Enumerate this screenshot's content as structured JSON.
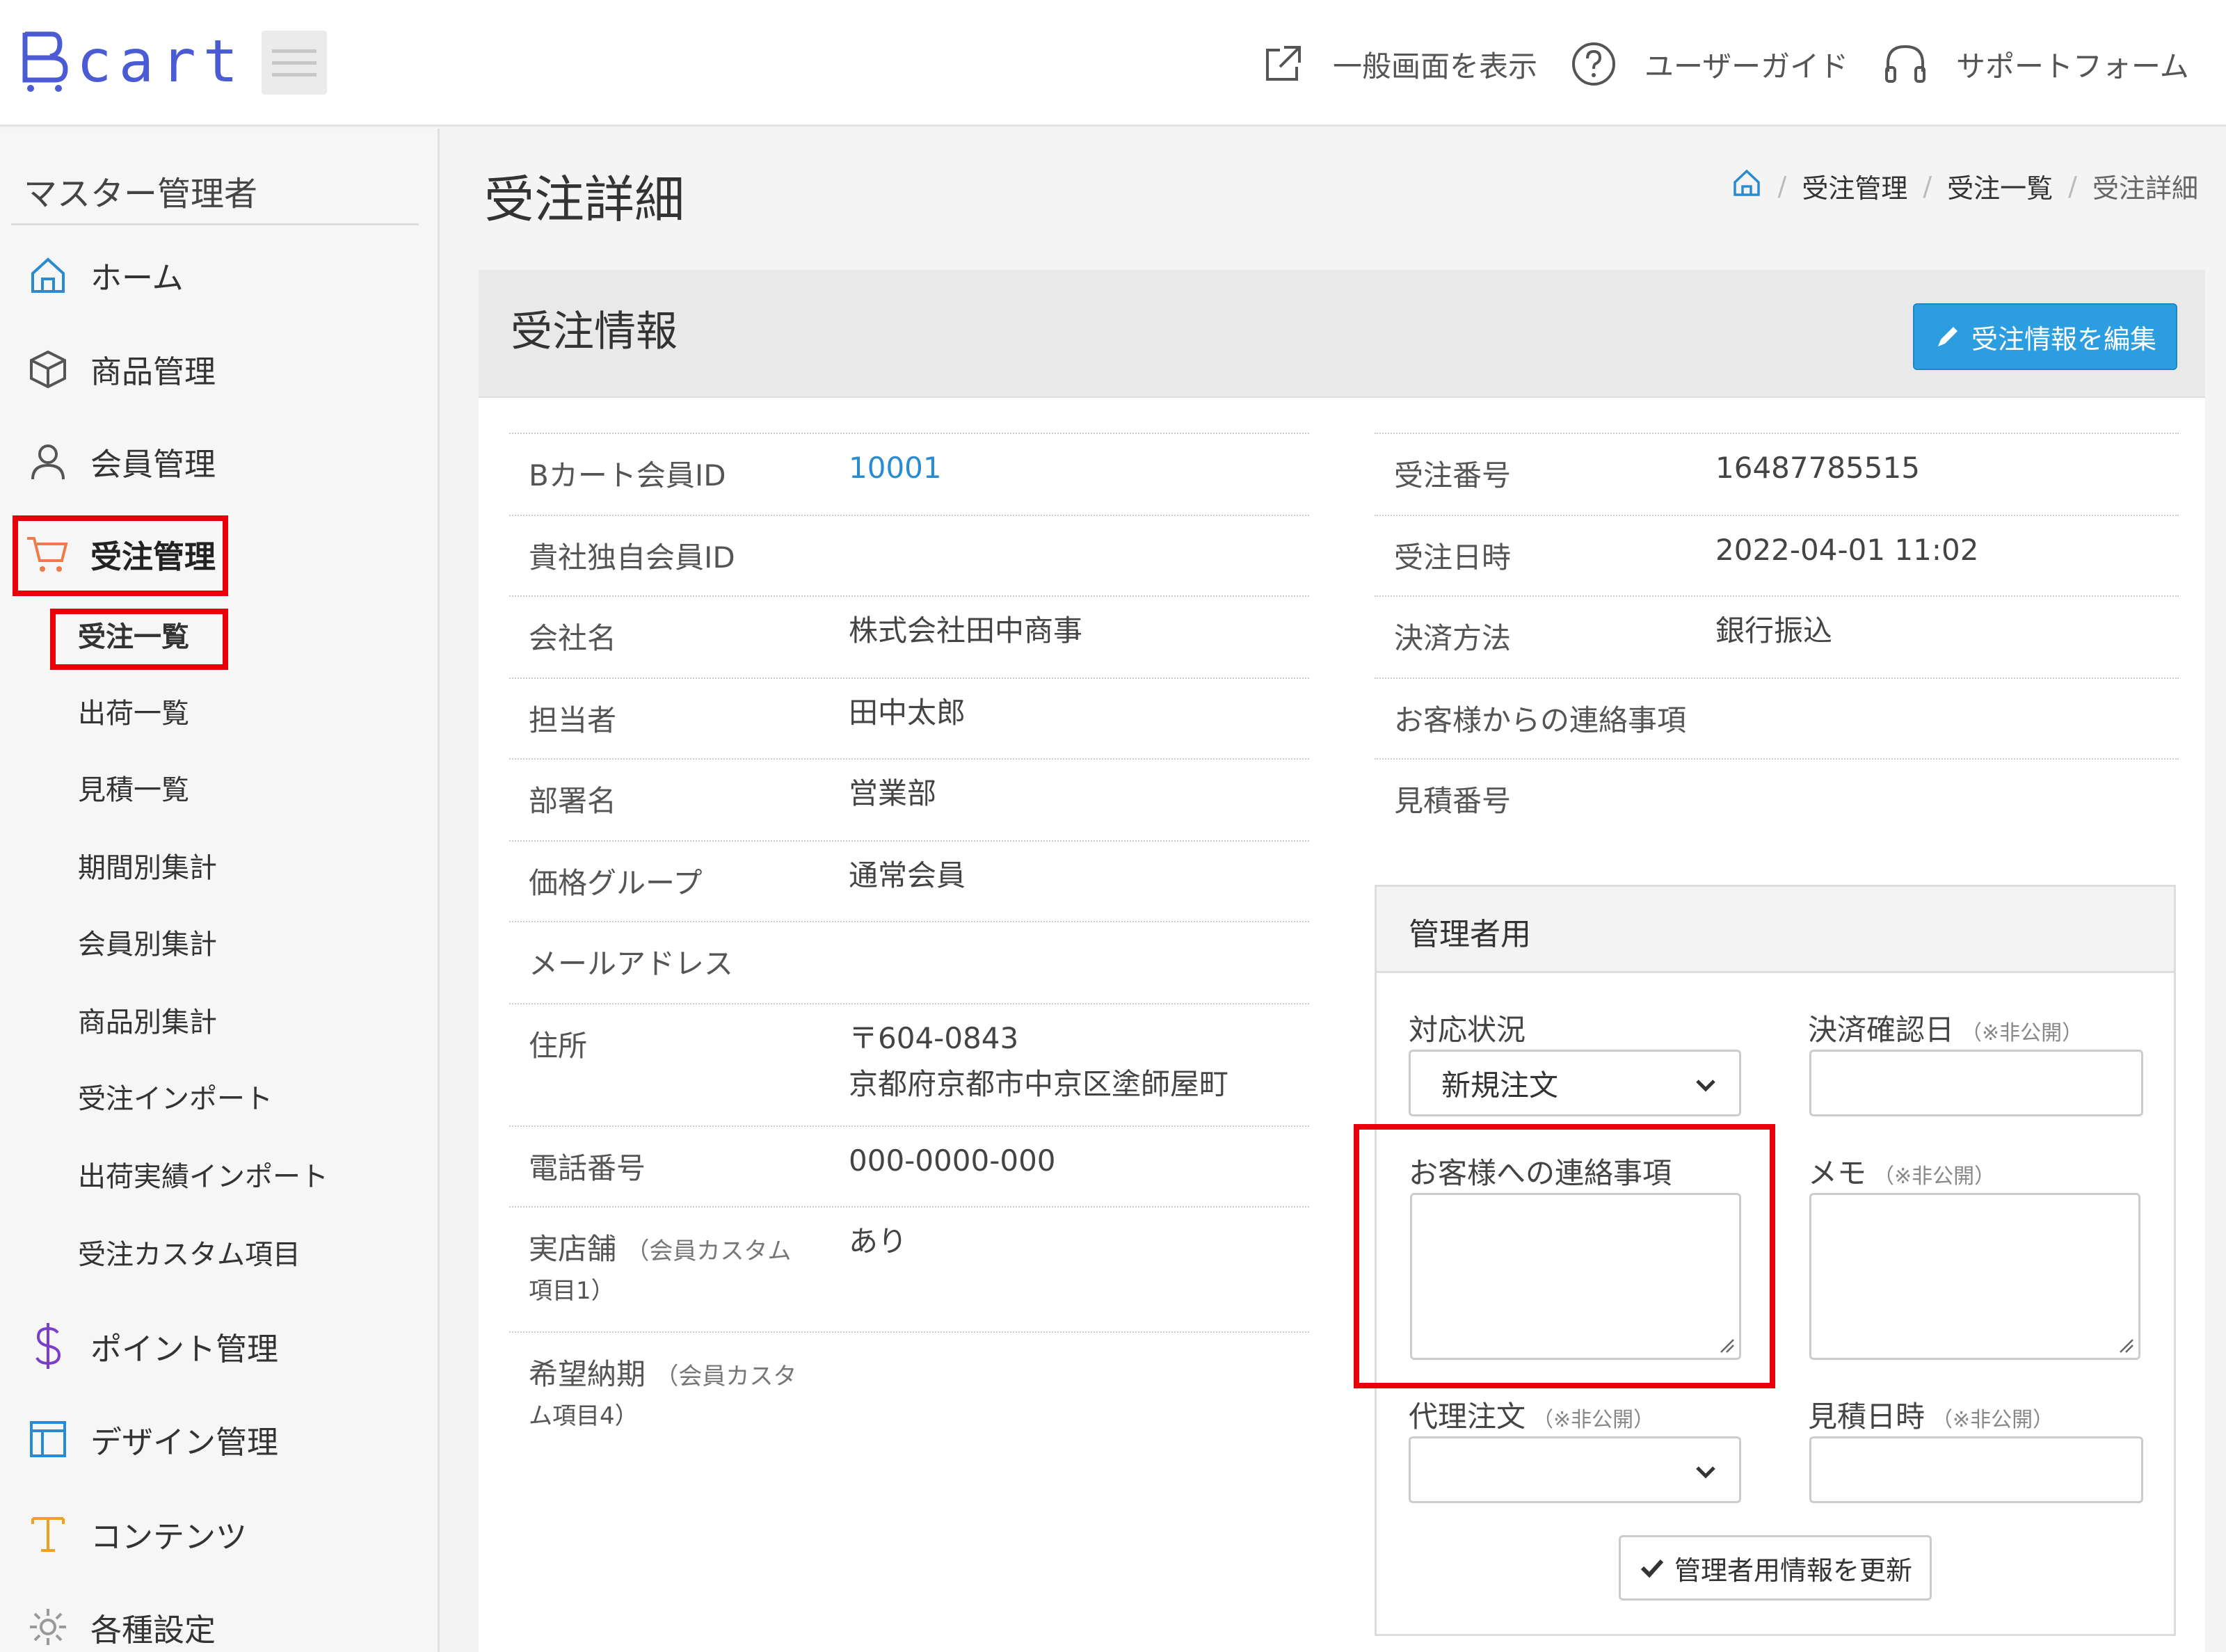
{
  "header": {
    "logo_text": "cart",
    "links": {
      "public_view": "一般画面を表示",
      "user_guide": "ユーザーガイド",
      "support_form": "サポートフォーム"
    }
  },
  "sidebar": {
    "title": "マスター管理者",
    "nav": {
      "home": "ホーム",
      "products": "商品管理",
      "members": "会員管理",
      "orders": "受注管理",
      "points": "ポイント管理",
      "design": "デザイン管理",
      "contents": "コンテンツ",
      "settings": "各種設定"
    },
    "orders_sub": {
      "order_list": "受注一覧",
      "shipping_list": "出荷一覧",
      "estimate_list": "見積一覧",
      "period_totals": "期間別集計",
      "member_totals": "会員別集計",
      "product_totals": "商品別集計",
      "order_import": "受注インポート",
      "shipping_import": "出荷実績インポート",
      "custom_fields": "受注カスタム項目"
    }
  },
  "page": {
    "title": "受注詳細",
    "breadcrumb": {
      "level1": "受注管理",
      "level2": "受注一覧",
      "current": "受注詳細"
    }
  },
  "card": {
    "title": "受注情報",
    "edit_button": "受注情報を編集",
    "left": {
      "bcart_member_id": {
        "label": "Bカート会員ID",
        "value": "10001"
      },
      "own_member_id": {
        "label": "貴社独自会員ID",
        "value": ""
      },
      "company": {
        "label": "会社名",
        "value": "株式会社田中商事"
      },
      "person": {
        "label": "担当者",
        "value": "田中太郎"
      },
      "department": {
        "label": "部署名",
        "value": "営業部"
      },
      "price_group": {
        "label": "価格グループ",
        "value": "通常会員"
      },
      "email": {
        "label": "メールアドレス",
        "value": ""
      },
      "address": {
        "label": "住所",
        "postal": "〒604-0843",
        "line1": "京都府京都市中京区塗師屋町"
      },
      "phone": {
        "label": "電話番号",
        "value": "000-0000-000"
      },
      "store": {
        "label": "実店舗",
        "note_line1": "（会員カスタム",
        "note_line2": "項目1）",
        "value": "あり"
      },
      "delivery": {
        "label": "希望納期",
        "note_line1": "（会員カスタ",
        "note_line2": "ム項目4）",
        "value": ""
      }
    },
    "right": {
      "order_number": {
        "label": "受注番号",
        "value": "16487785515"
      },
      "order_date": {
        "label": "受注日時",
        "value": "2022-04-01 11:02"
      },
      "payment": {
        "label": "決済方法",
        "value": "銀行振込"
      },
      "customer_message": {
        "label": "お客様からの連絡事項",
        "value": ""
      },
      "estimate_number": {
        "label": "見積番号",
        "value": ""
      }
    }
  },
  "admin": {
    "title": "管理者用",
    "status": {
      "label": "対応状況",
      "value": "新規注文"
    },
    "payment_confirm": {
      "label": "決済確認日",
      "note": "（※非公開）"
    },
    "customer_note": {
      "label": "お客様への連絡事項"
    },
    "memo": {
      "label": "メモ",
      "note": "（※非公開）"
    },
    "proxy_order": {
      "label": "代理注文",
      "note": "（※非公開）",
      "value": ""
    },
    "estimate_date": {
      "label": "見積日時",
      "note": "（※非公開）"
    },
    "update_button": "管理者用情報を更新"
  },
  "colors": {
    "accent": "#2c9ee0",
    "link": "#2a8bd0",
    "highlight": "#e8000b",
    "logo": "#4a5bd4",
    "cart_icon": "#f07a4a",
    "points_icon": "#7a3ec8",
    "design_icon": "#2a8bd0",
    "contents_icon": "#f0a020"
  }
}
